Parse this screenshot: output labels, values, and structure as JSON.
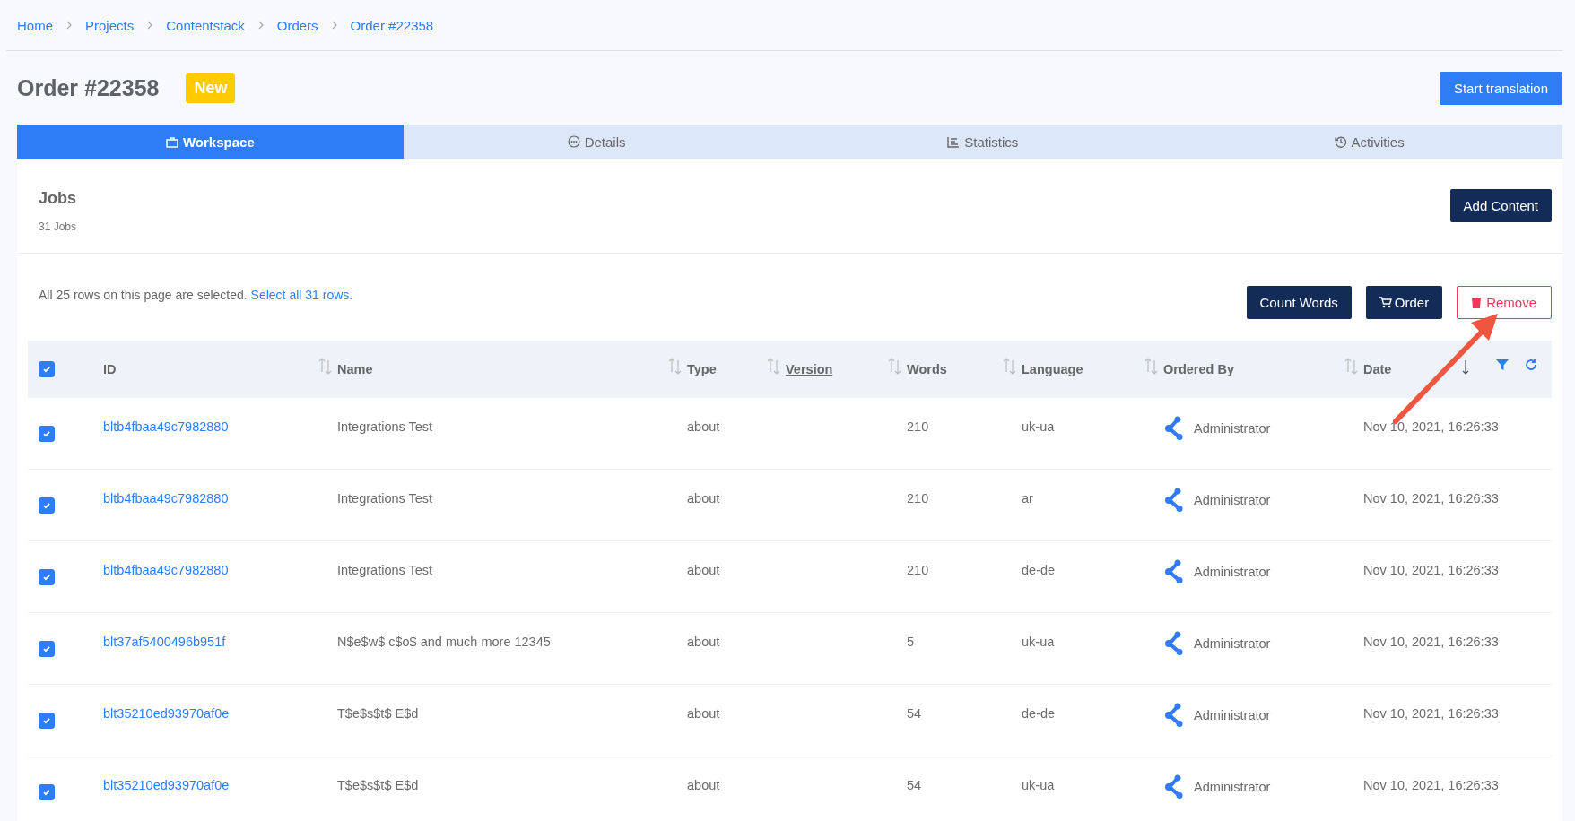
{
  "breadcrumb": [
    "Home",
    "Projects",
    "Contentstack",
    "Orders",
    "Order #22358"
  ],
  "title": "Order #22358",
  "status_badge": "New",
  "start_button": "Start translation",
  "tabs": [
    {
      "label": "Workspace",
      "selected": true
    },
    {
      "label": "Details",
      "selected": false
    },
    {
      "label": "Statistics",
      "selected": false
    },
    {
      "label": "Activities",
      "selected": false
    }
  ],
  "jobs": {
    "title": "Jobs",
    "count": "31 Jobs",
    "add_button": "Add Content"
  },
  "selection": {
    "message": "All 25 rows on this page are selected.",
    "link": "Select all 31 rows."
  },
  "actions": [
    {
      "label": "Count Words",
      "kind": "primary"
    },
    {
      "label": "Order",
      "kind": "cart"
    },
    {
      "label": "Remove",
      "kind": "danger"
    }
  ],
  "table": {
    "all_checked": true,
    "columns": [
      {
        "label": "ID",
        "sorted": false
      },
      {
        "label": "Name",
        "sorted": false
      },
      {
        "label": "Type",
        "sorted": false
      },
      {
        "label": "Version",
        "sorted": false,
        "underlined": true
      },
      {
        "label": "Words",
        "sorted": false
      },
      {
        "label": "Language",
        "sorted": false
      },
      {
        "label": "Ordered By",
        "sorted": false
      },
      {
        "label": "Date",
        "sorted": true
      }
    ],
    "rows": [
      {
        "checked": true,
        "id": "bltb4fbaa49c7982880",
        "name": "Integrations Test",
        "type": "about",
        "words": "210",
        "language": "uk-ua",
        "ordered_by": "Administrator",
        "date": "Nov 10, 2021, 16:26:33"
      },
      {
        "checked": true,
        "id": "bltb4fbaa49c7982880",
        "name": "Integrations Test",
        "type": "about",
        "words": "210",
        "language": "ar",
        "ordered_by": "Administrator",
        "date": "Nov 10, 2021, 16:26:33"
      },
      {
        "checked": true,
        "id": "bltb4fbaa49c7982880",
        "name": "Integrations Test",
        "type": "about",
        "words": "210",
        "language": "de-de",
        "ordered_by": "Administrator",
        "date": "Nov 10, 2021, 16:26:33"
      },
      {
        "checked": true,
        "id": "blt37af5400496b951f",
        "name": "N$e$w$ c$o$ and much more 12345",
        "type": "about",
        "words": "5",
        "language": "uk-ua",
        "ordered_by": "Administrator",
        "date": "Nov 10, 2021, 16:26:33"
      },
      {
        "checked": true,
        "id": "blt35210ed93970af0e",
        "name": "T$e$s$t$ E$d",
        "type": "about",
        "words": "54",
        "language": "de-de",
        "ordered_by": "Administrator",
        "date": "Nov 10, 2021, 16:26:33"
      },
      {
        "checked": true,
        "id": "blt35210ed93970af0e",
        "name": "T$e$s$t$ E$d",
        "type": "about",
        "words": "54",
        "language": "uk-ua",
        "ordered_by": "Administrator",
        "date": "Nov 10, 2021, 16:26:33"
      }
    ]
  }
}
